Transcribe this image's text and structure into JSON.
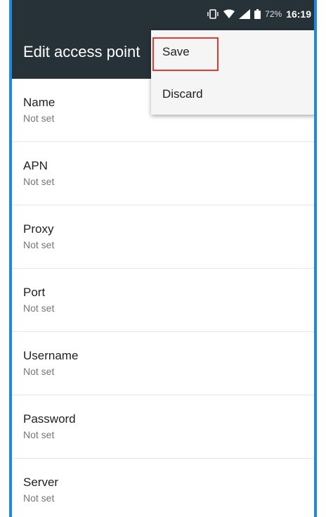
{
  "status_bar": {
    "icons": [
      "vibrate-icon",
      "wifi-icon",
      "signal-icon",
      "battery-icon"
    ],
    "battery_percent": "72%",
    "time": "16:19"
  },
  "toolbar": {
    "title": "Edit access point"
  },
  "fields": [
    {
      "label": "Name",
      "value": "Not set"
    },
    {
      "label": "APN",
      "value": "Not set"
    },
    {
      "label": "Proxy",
      "value": "Not set"
    },
    {
      "label": "Port",
      "value": "Not set"
    },
    {
      "label": "Username",
      "value": "Not set"
    },
    {
      "label": "Password",
      "value": "Not set"
    },
    {
      "label": "Server",
      "value": "Not set"
    }
  ],
  "overflow_menu": {
    "items": [
      {
        "label": "Save"
      },
      {
        "label": "Discard"
      }
    ],
    "highlight_color": "#e53935"
  },
  "colors": {
    "app_bar": "#263238",
    "frame": "#1e88e5"
  }
}
